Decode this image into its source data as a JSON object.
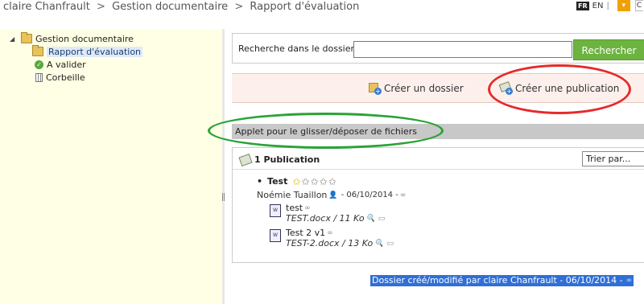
{
  "breadcrumb": {
    "user": "claire Chanfrault",
    "section": "Gestion documentaire",
    "page": "Rapport d'évaluation",
    "separator": ">"
  },
  "lang": {
    "current": "FR",
    "alternate": "EN",
    "divider": "|"
  },
  "tree": {
    "root": "Gestion documentaire",
    "items": [
      {
        "label": "Rapport d'évaluation",
        "icon": "folder-icon",
        "selected": true
      },
      {
        "label": "A valider",
        "icon": "check-icon"
      },
      {
        "label": "Corbeille",
        "icon": "trash-icon"
      }
    ]
  },
  "search": {
    "label": "Recherche dans le dossier :",
    "value": "",
    "button": "Rechercher"
  },
  "actions": {
    "create_folder": "Créer un dossier",
    "create_publication": "Créer une publication"
  },
  "applet": {
    "label": "Applet pour le glisser/déposer de fichiers"
  },
  "publications": {
    "count_label": "1 Publication",
    "sort_label": "Trier par...",
    "items": [
      {
        "title": "Test",
        "author": "Noémie Tuaillon",
        "date": "- 06/10/2014 -",
        "files": [
          {
            "name": "test",
            "meta": "TEST.docx / 11 Ko"
          },
          {
            "name": "Test 2 v1",
            "meta": "TEST-2.docx / 13 Ko"
          }
        ]
      }
    ]
  },
  "footer": {
    "text": "Dossier créé/modifié par claire Chanfrault - 06/10/2014 -"
  },
  "colors": {
    "sidebar_bg": "#ffffe5",
    "search_button": "#6cb33f",
    "action_bar_bg": "#fdf0ec",
    "red_annotation": "#e52a2a",
    "green_annotation": "#2aa336",
    "footer_highlight": "#2f6fd6"
  }
}
